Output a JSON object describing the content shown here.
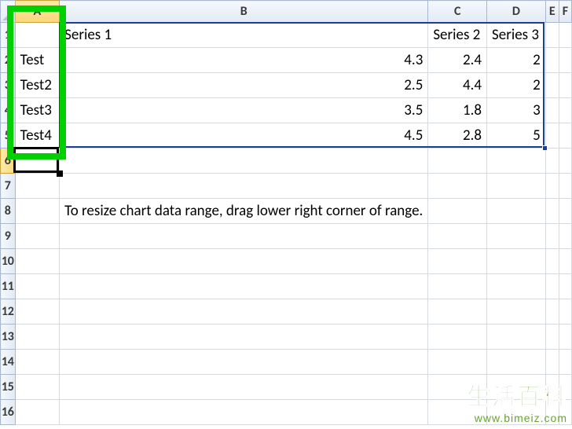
{
  "columns": [
    "A",
    "B",
    "C",
    "D",
    "E",
    "F"
  ],
  "row_count": 16,
  "headers": {
    "B1": "Series 1",
    "C1": "Series 2",
    "D1": "Series 3"
  },
  "labels": {
    "A2": "Test",
    "A3": "Test2",
    "A4": "Test3",
    "A5": "Test4"
  },
  "values": {
    "B2": 4.3,
    "C2": 2.4,
    "D2": 2,
    "B3": 2.5,
    "C3": 4.4,
    "D3": 2,
    "B4": 3.5,
    "C4": 1.8,
    "D4": 3,
    "B5": 4.5,
    "C5": 2.8,
    "D5": 5
  },
  "instruction_cell": "B8",
  "instruction_text": "To resize chart data range, drag lower right corner of range.",
  "active_cell": "A6",
  "selection_range": "B1:D5",
  "highlight_column_range": "A1:A5",
  "chart_data": {
    "type": "table",
    "categories": [
      "Test",
      "Test2",
      "Test3",
      "Test4"
    ],
    "series": [
      {
        "name": "Series 1",
        "values": [
          4.3,
          2.5,
          3.5,
          4.5
        ]
      },
      {
        "name": "Series 2",
        "values": [
          2.4,
          4.4,
          1.8,
          2.8
        ]
      },
      {
        "name": "Series 3",
        "values": [
          2,
          2,
          3,
          5
        ]
      }
    ]
  },
  "watermark": {
    "title": "生活百科",
    "url": "www.bimeiz.com"
  }
}
